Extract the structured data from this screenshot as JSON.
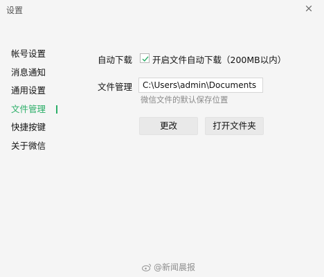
{
  "window": {
    "title": "设置",
    "close_icon": "×"
  },
  "sidebar": {
    "items": [
      {
        "label": "帐号设置"
      },
      {
        "label": "消息通知"
      },
      {
        "label": "通用设置"
      },
      {
        "label": "文件管理",
        "active": true
      },
      {
        "label": "快捷按键"
      },
      {
        "label": "关于微信"
      }
    ],
    "accent": "#2aae67"
  },
  "auto_download": {
    "label": "自动下载",
    "checkbox_label": "开启文件自动下载（200MB以内）",
    "checked": true
  },
  "file_management": {
    "label": "文件管理",
    "path": "C:\\Users\\admin\\Documents",
    "hint": "微信文件的默认保存位置"
  },
  "buttons": {
    "change": "更改",
    "open_folder": "打开文件夹"
  },
  "watermark": {
    "text": "@新闻晨报",
    "icon": "weibo-icon"
  }
}
